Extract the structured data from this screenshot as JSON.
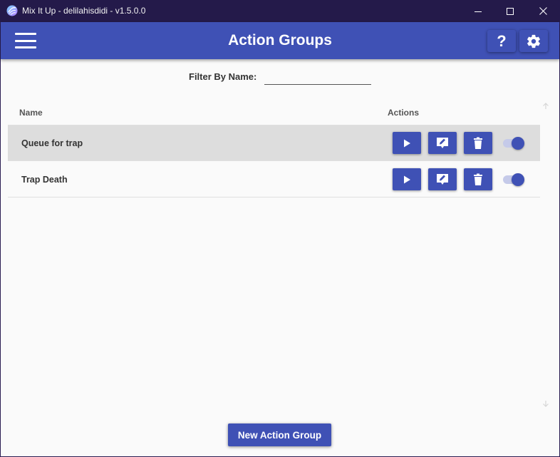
{
  "window": {
    "title": "Mix It Up - delilahisdidi - v1.5.0.0",
    "logo_icon": "mix-it-up-logo",
    "controls": [
      "minimize-icon",
      "maximize-icon",
      "close-icon"
    ]
  },
  "header": {
    "title": "Action Groups",
    "menu_icon": "hamburger-menu-icon",
    "help_label": "?",
    "settings_icon": "gear-icon",
    "background": "#3f51b5"
  },
  "filter": {
    "label": "Filter By Name:",
    "value": "",
    "placeholder": ""
  },
  "table": {
    "columns": [
      "Name",
      "Actions"
    ],
    "rows": [
      {
        "name": "Queue for trap",
        "selected": true,
        "enabled": true
      },
      {
        "name": "Trap Death",
        "selected": false,
        "enabled": true
      }
    ],
    "row_actions": [
      "play-icon",
      "edit-icon",
      "delete-icon",
      "enable-toggle"
    ]
  },
  "footer": {
    "new_button_label": "New Action Group"
  },
  "colors": {
    "accent": "#3f51b5",
    "titlebar": "#241a4a",
    "selected_row": "#dddddd",
    "content_bg": "#fafafa"
  }
}
